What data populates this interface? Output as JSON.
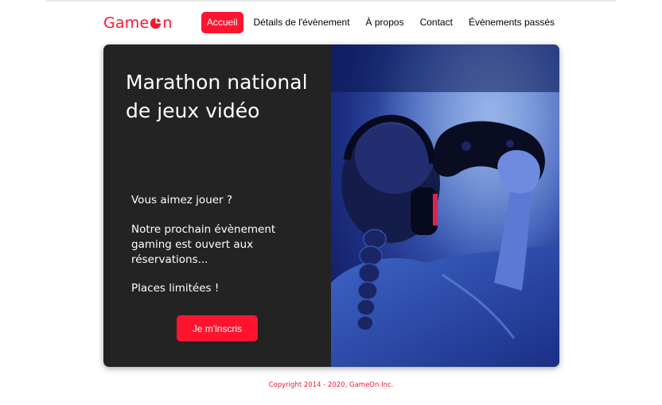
{
  "brand": {
    "logo_text_start": "Game",
    "logo_text_end": "n",
    "accent": "#fe142f"
  },
  "nav": {
    "items": [
      {
        "label": "Accueil",
        "active": true
      },
      {
        "label": "Détails de l'évènement",
        "active": false
      },
      {
        "label": "À propos",
        "active": false
      },
      {
        "label": "Contact",
        "active": false
      },
      {
        "label": "Évènements passés",
        "active": false
      }
    ]
  },
  "hero": {
    "title": "Marathon national de jeux vidéo",
    "paragraphs": [
      "Vous aimez jouer ?",
      "Notre prochain évènement gaming est ouvert aux réservations...",
      "Places limitées !"
    ],
    "cta_label": "Je m'inscris",
    "image": "photo of a gamer with headset holding a controller",
    "left_panel_color": "#232323"
  },
  "footer": {
    "copyright": "Copyright 2014 - 2020, GameOn Inc."
  }
}
